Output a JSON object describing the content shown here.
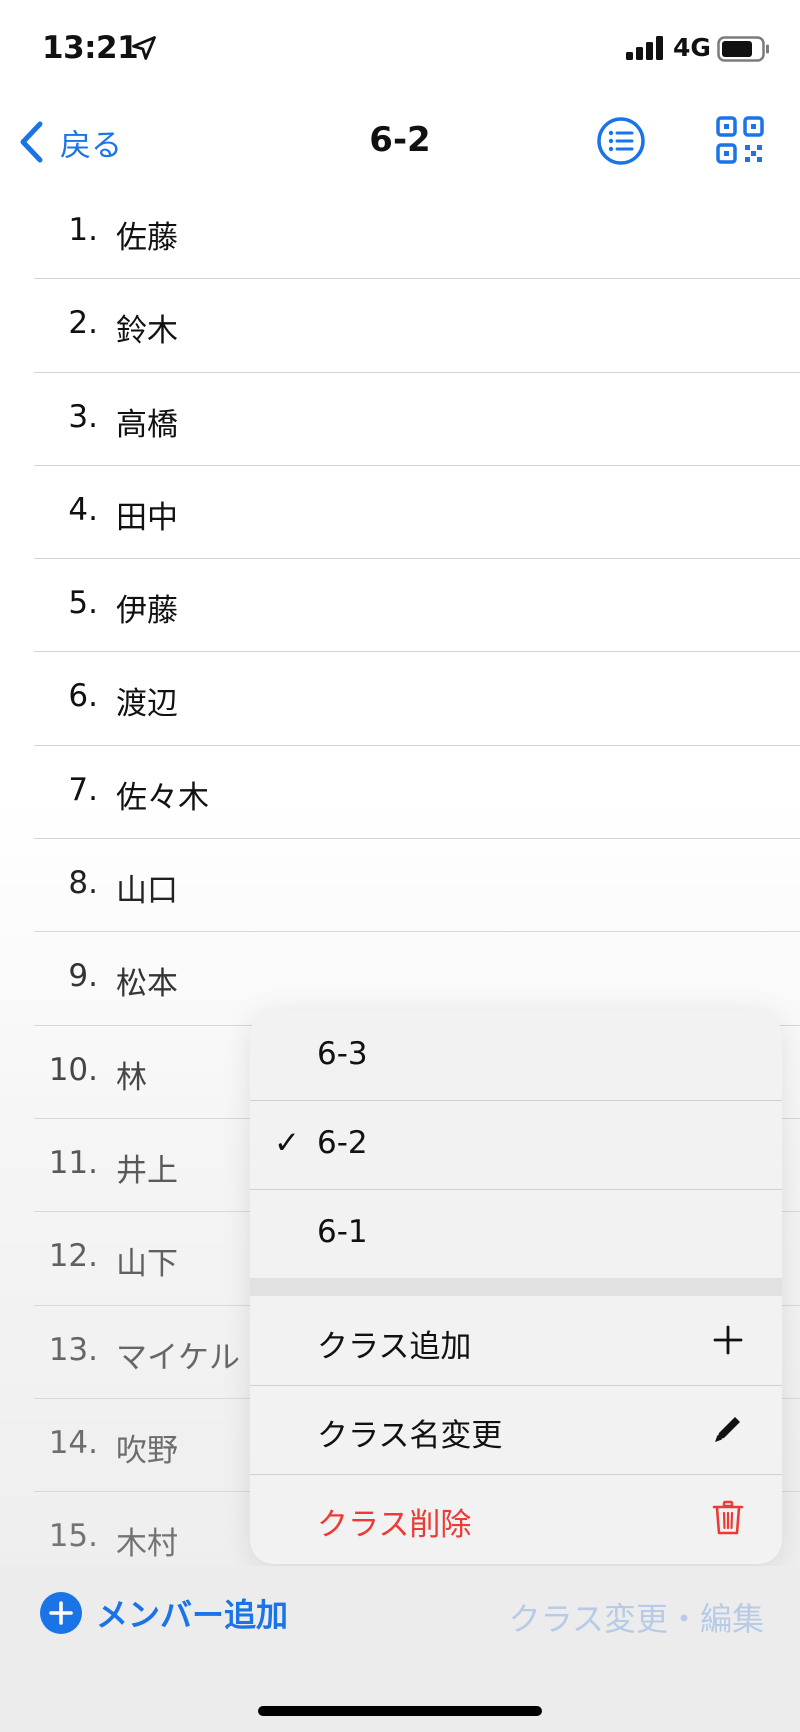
{
  "status_bar": {
    "time": "13:21",
    "network": "4G"
  },
  "nav": {
    "back_label": "戻る",
    "title": "6-2"
  },
  "members": [
    {
      "num": "1.",
      "name": "佐藤"
    },
    {
      "num": "2.",
      "name": "鈴木"
    },
    {
      "num": "3.",
      "name": "高橋"
    },
    {
      "num": "4.",
      "name": "田中"
    },
    {
      "num": "5.",
      "name": "伊藤"
    },
    {
      "num": "6.",
      "name": "渡辺"
    },
    {
      "num": "7.",
      "name": "佐々木"
    },
    {
      "num": "8.",
      "name": "山口"
    },
    {
      "num": "9.",
      "name": "松本"
    },
    {
      "num": "10.",
      "name": "林"
    },
    {
      "num": "11.",
      "name": "井上"
    },
    {
      "num": "12.",
      "name": "山下"
    },
    {
      "num": "13.",
      "name": "マイケル"
    },
    {
      "num": "14.",
      "name": "吹野"
    },
    {
      "num": "15.",
      "name": "木村"
    }
  ],
  "menu": {
    "classes": [
      {
        "label": "6-3",
        "selected": false
      },
      {
        "label": "6-2",
        "selected": true
      },
      {
        "label": "6-1",
        "selected": false
      }
    ],
    "check_mark": "✓",
    "add_class": "クラス追加",
    "rename_class": "クラス名変更",
    "delete_class": "クラス削除"
  },
  "toolbar": {
    "add_member": "メンバー追加",
    "edit_class": "クラス変更・編集"
  },
  "colors": {
    "accent": "#1a74e8",
    "danger": "#ec3b34",
    "disabled": "#b7cbe6"
  },
  "icons": {
    "location": "location-arrow-icon",
    "signal": "cellular-signal-icon",
    "battery": "battery-icon",
    "back": "chevron-left-icon",
    "list": "list-circle-icon",
    "qr": "qr-code-icon",
    "add": "plus-icon",
    "rename": "pencil-icon",
    "delete": "trash-icon",
    "add_member": "plus-circle-icon"
  }
}
